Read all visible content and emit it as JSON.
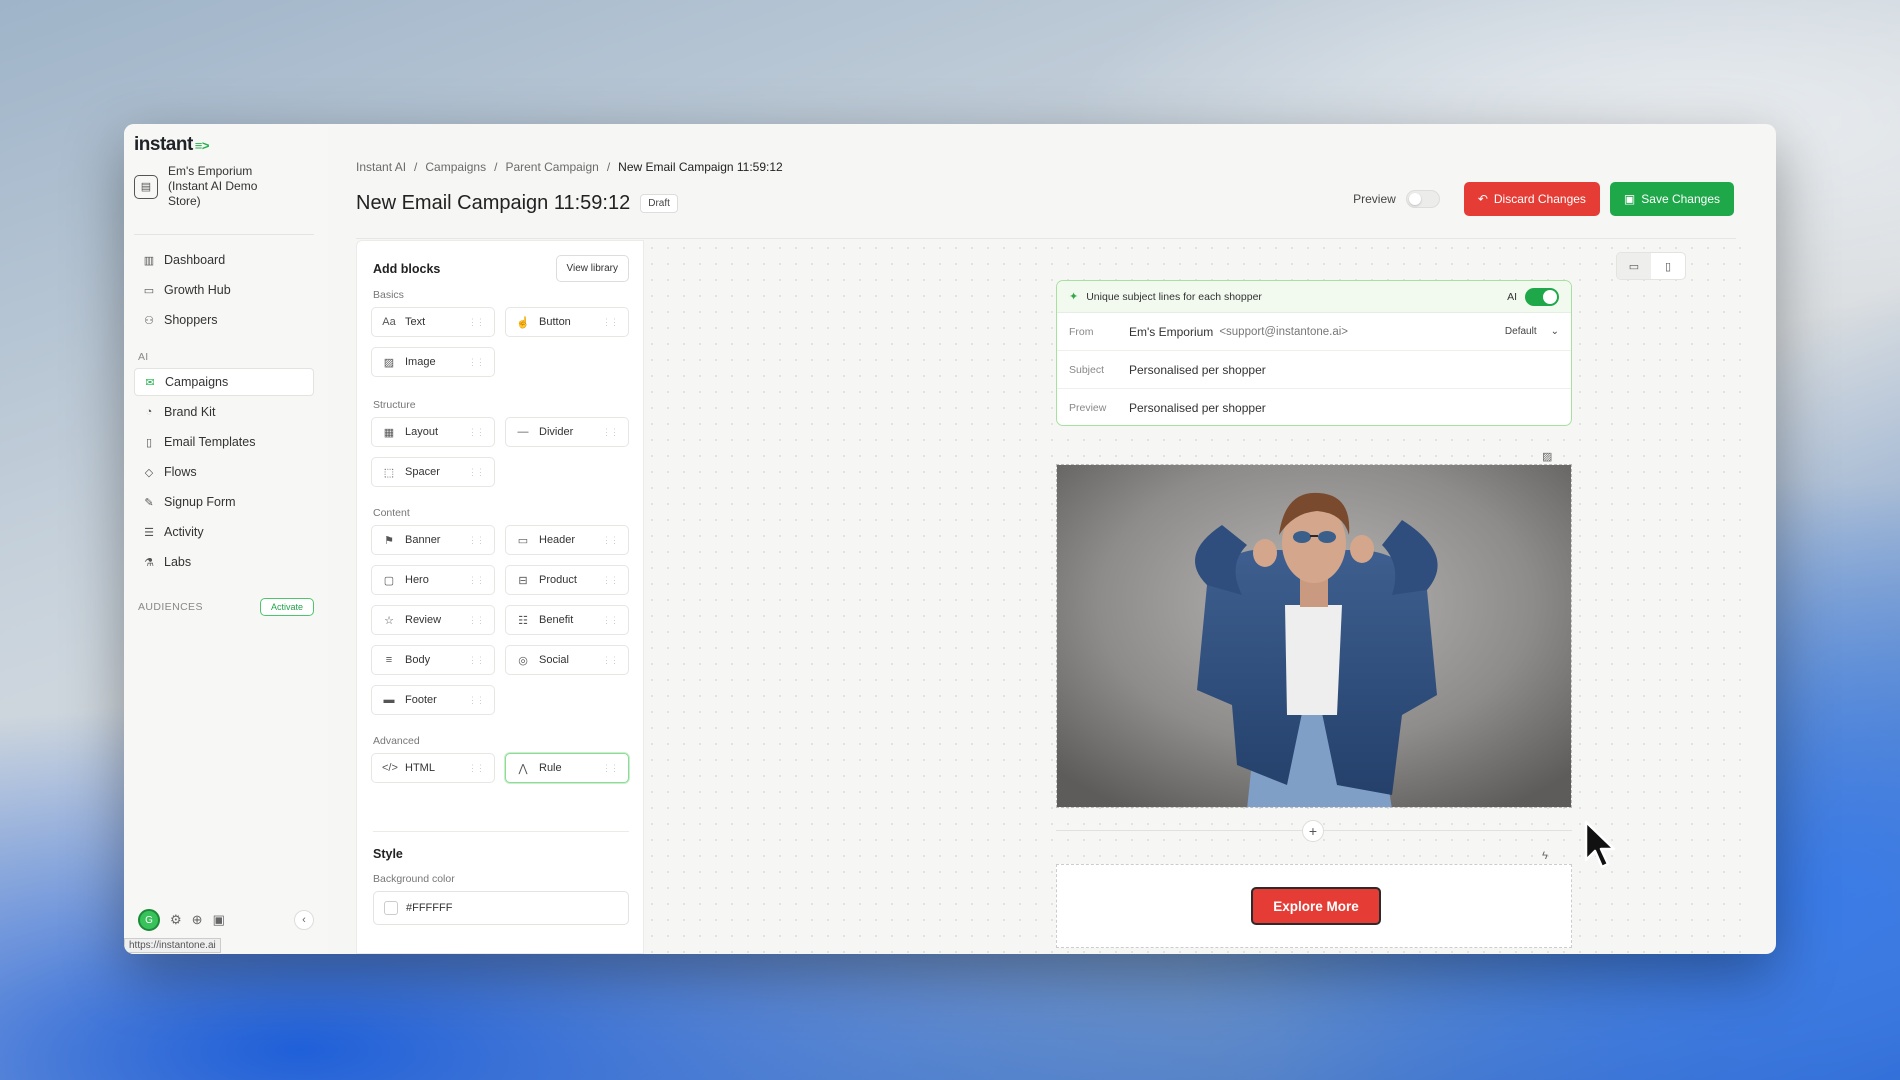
{
  "logo": {
    "text": "instant",
    "mark": "≡>"
  },
  "store": {
    "name": "Em's Emporium (Instant AI Demo Store)"
  },
  "nav": {
    "main": [
      {
        "label": "Dashboard",
        "icon": "bar-chart-icon"
      },
      {
        "label": "Growth Hub",
        "icon": "chat-icon"
      },
      {
        "label": "Shoppers",
        "icon": "users-icon"
      }
    ],
    "ai_label": "AI",
    "ai": [
      {
        "label": "Campaigns",
        "icon": "mail-icon",
        "active": true
      },
      {
        "label": "Brand Kit",
        "icon": "palette-icon"
      },
      {
        "label": "Email Templates",
        "icon": "template-icon"
      },
      {
        "label": "Flows",
        "icon": "flow-icon"
      },
      {
        "label": "Signup Form",
        "icon": "form-icon"
      },
      {
        "label": "Activity",
        "icon": "activity-icon"
      },
      {
        "label": "Labs",
        "icon": "flask-icon"
      }
    ],
    "audiences_label": "AUDIENCES",
    "activate_label": "Activate"
  },
  "footer": {
    "avatar": "G",
    "url_tip": "https://instantone.ai"
  },
  "breadcrumb": [
    "Instant AI",
    "Campaigns",
    "Parent Campaign",
    "New Email Campaign 11:59:12"
  ],
  "page": {
    "title": "New Email Campaign 11:59:12",
    "status": "Draft"
  },
  "actions": {
    "preview_label": "Preview",
    "discard_label": "Discard Changes",
    "save_label": "Save Changes"
  },
  "blocks_panel": {
    "title": "Add blocks",
    "view_library": "View library",
    "sections": {
      "basics": "Basics",
      "structure": "Structure",
      "content": "Content",
      "advanced": "Advanced"
    },
    "basics": [
      "Text",
      "Button",
      "Image"
    ],
    "structure": [
      "Layout",
      "Divider",
      "Spacer"
    ],
    "content": [
      "Banner",
      "Header",
      "Hero",
      "Product",
      "Review",
      "Benefit",
      "Body",
      "Social",
      "Footer"
    ],
    "advanced": [
      "HTML",
      "Rule"
    ],
    "style_title": "Style",
    "bg_color_label": "Background color",
    "bg_color_value": "#FFFFFF"
  },
  "email": {
    "ai_banner": "Unique subject lines for each shopper",
    "ai_label": "AI",
    "from_label": "From",
    "from_name": "Em's Emporium",
    "from_addr": "<support@instantone.ai>",
    "from_select": "Default",
    "subject_label": "Subject",
    "subject_value": "Personalised per shopper",
    "preview_label": "Preview",
    "preview_value": "Personalised per shopper",
    "cta_label": "Explore More"
  },
  "colors": {
    "accent_green": "#1fa84a",
    "danger_red": "#e53d35"
  }
}
